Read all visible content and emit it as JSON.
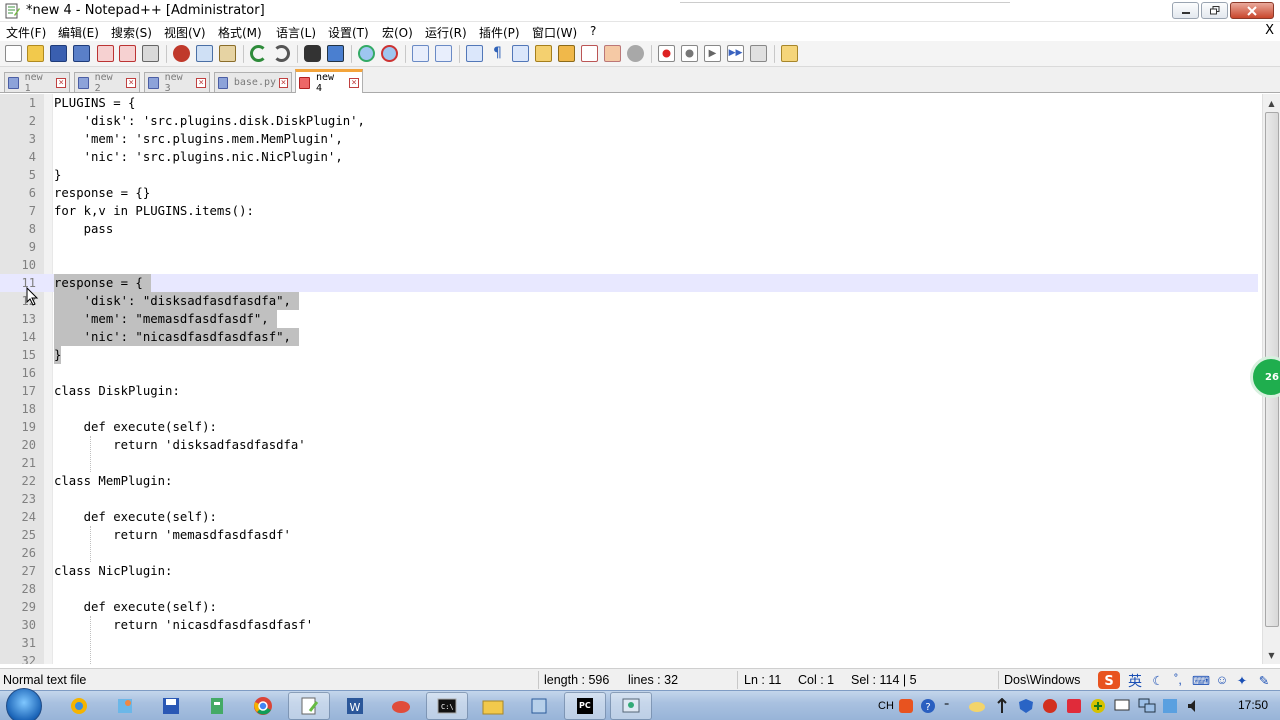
{
  "window": {
    "title": "*new 4 - Notepad++ [Administrator]",
    "close_x": "X"
  },
  "menu": [
    {
      "label": "文件(F)"
    },
    {
      "label": "编辑(E)"
    },
    {
      "label": "搜索(S)"
    },
    {
      "label": "视图(V)"
    },
    {
      "label": "格式(M)"
    },
    {
      "label": "语言(L)"
    },
    {
      "label": "设置(T)"
    },
    {
      "label": "宏(O)"
    },
    {
      "label": "运行(R)"
    },
    {
      "label": "插件(P)"
    },
    {
      "label": "窗口(W)"
    },
    {
      "label": "?"
    }
  ],
  "toolbar_icons": [
    "new-file-icon",
    "open-file-icon",
    "save-icon",
    "save-all-icon",
    "close-icon",
    "close-all-icon",
    "print-icon",
    "cut-icon",
    "copy-icon",
    "paste-icon",
    "undo-icon",
    "redo-icon",
    "find-icon",
    "replace-icon",
    "zoom-in-icon",
    "zoom-out-icon",
    "sync-vertical-icon",
    "sync-horizontal-icon",
    "word-wrap-icon",
    "show-all-chars-icon",
    "indent-guide-icon",
    "udl-icon",
    "doc-map-icon",
    "function-list-icon",
    "folder-workspace-icon",
    "monitoring-icon",
    "record-macro-icon",
    "stop-macro-icon",
    "play-macro-icon",
    "run-macro-multiple-icon",
    "save-macro-icon",
    "plugin-icon"
  ],
  "tabs": [
    {
      "label": "new 1",
      "active": false
    },
    {
      "label": "new 2",
      "active": false
    },
    {
      "label": "new 3",
      "active": false
    },
    {
      "label": "base.py",
      "active": false
    },
    {
      "label": "new 4",
      "active": true
    }
  ],
  "editor": {
    "lines": [
      "PLUGINS = {",
      "    'disk': 'src.plugins.disk.DiskPlugin',",
      "    'mem': 'src.plugins.mem.MemPlugin',",
      "    'nic': 'src.plugins.nic.NicPlugin',",
      "}",
      "response = {}",
      "for k,v in PLUGINS.items():",
      "    pass",
      "",
      "",
      "response = {",
      "    'disk': \"disksadfasdfasdfa\",",
      "    'mem': \"memasdfasdfasdf\",",
      "    'nic': \"nicasdfasdfasdfasf\",",
      "}",
      "",
      "class DiskPlugin:",
      "",
      "    def execute(self):",
      "        return 'disksadfasdfasdfa'",
      "",
      "class MemPlugin:",
      "",
      "    def execute(self):",
      "        return 'memasdfasdfasdf'",
      "",
      "class NicPlugin:",
      "",
      "    def execute(self):",
      "        return 'nicasdfasdfasdfasf'",
      "",
      ""
    ],
    "line_numbers": [
      "1",
      "2",
      "3",
      "4",
      "5",
      "6",
      "7",
      "8",
      "9",
      "10",
      "11",
      "12",
      "13",
      "14",
      "15",
      "16",
      "17",
      "18",
      "19",
      "20",
      "21",
      "22",
      "23",
      "24",
      "25",
      "26",
      "27",
      "28",
      "29",
      "30",
      "31",
      "32"
    ],
    "current_line": 11,
    "selected_lines": [
      11,
      12,
      13,
      14,
      15
    ]
  },
  "side_badge": "26",
  "status": {
    "file_type": "Normal text file",
    "length": "length : 596",
    "lines": "lines : 32",
    "ln": "Ln : 11",
    "col": "Col : 1",
    "sel": "Sel : 114 | 5",
    "eol": "Dos\\Windows",
    "ime_lang": "英"
  },
  "taskbar": {
    "apps": [
      "start-button",
      "browser-app",
      "paint-app",
      "save-app",
      "network-app",
      "chrome-app",
      "notepadpp-app",
      "word-app",
      "mail-app",
      "terminal-app",
      "explorer-app",
      "virtualbox-app",
      "pycharm-app",
      "remote-app"
    ],
    "tray_lang": "CH",
    "clock": "17:50"
  },
  "colors": {
    "accent_tab": "#f3a43b",
    "selection": "#c0c0c0",
    "current_line": "#e8e8ff",
    "gutter": "#e4e4e4"
  }
}
